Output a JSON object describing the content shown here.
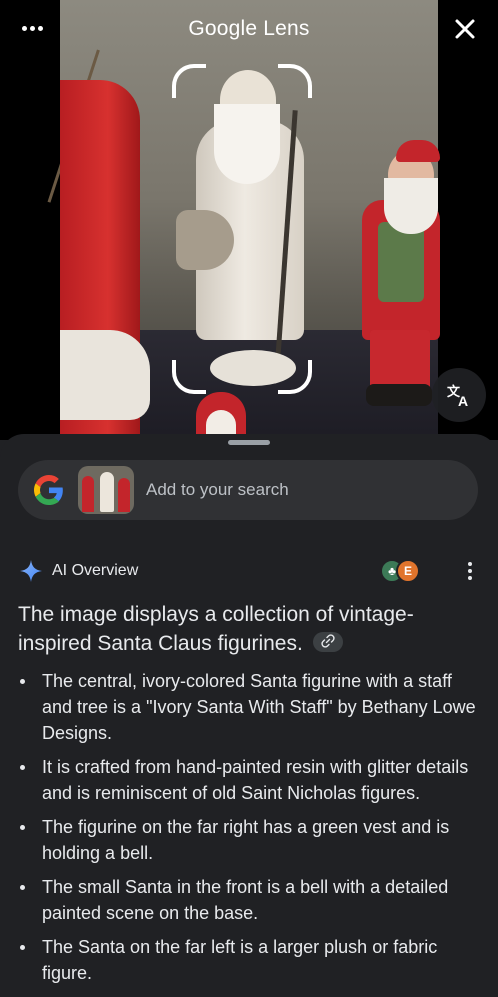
{
  "header": {
    "title": "Google Lens",
    "menu_icon": "more-horizontal-icon",
    "close_icon": "close-icon"
  },
  "photo": {
    "translate_icon": "translate-icon"
  },
  "search": {
    "placeholder": "Add to your search",
    "logo": "google-g-icon"
  },
  "ai_overview": {
    "label": "AI Overview",
    "source_badges": [
      "tree-favicon",
      "E"
    ],
    "summary": "The image displays a collection of vintage-inspired Santa Claus figurines.",
    "link_icon": "link-icon",
    "bullets": [
      "The central, ivory-colored Santa figurine with a staff and tree is a \"Ivory Santa With Staff\" by Bethany Lowe Designs.",
      "It is crafted from hand-painted resin with glitter details and is reminiscent of old Saint Nicholas figures.",
      "The figurine on the far right has a green vest and is holding a bell.",
      "The small Santa in the front is a bell with a detailed painted scene on the base.",
      "The Santa on the far left is a larger plush or fabric figure."
    ]
  },
  "colors": {
    "sheet_bg": "#202124",
    "pill_bg": "#303134",
    "text": "#e8eaed",
    "muted": "#bdc1c6"
  }
}
